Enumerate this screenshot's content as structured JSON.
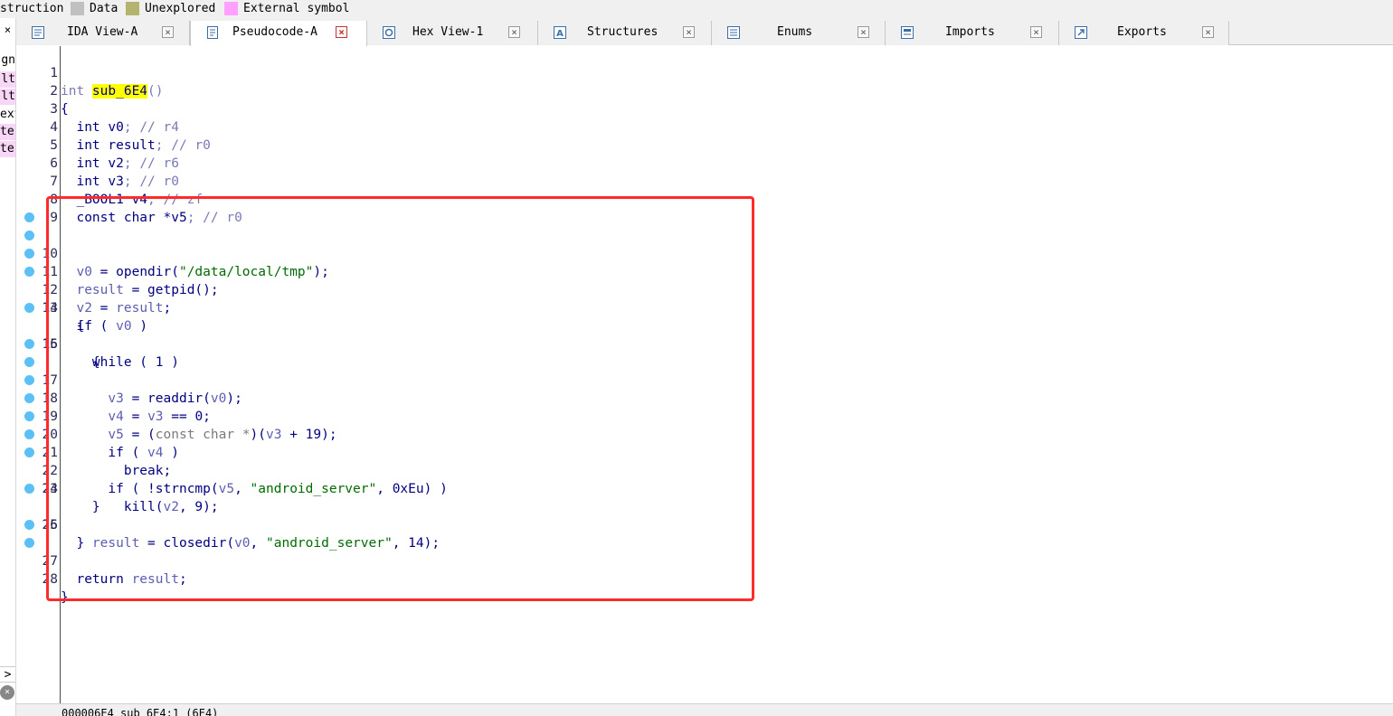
{
  "legend": [
    {
      "label": "struction",
      "color": ""
    },
    {
      "label": "Data",
      "color": "#c0c0c0"
    },
    {
      "label": "Unexplored",
      "color": "#b4b46e"
    },
    {
      "label": "External symbol",
      "color": "#ffa0ff"
    }
  ],
  "left_panel": {
    "close_glyph": "×",
    "rows": [
      "gn",
      "lt",
      "lt",
      "ext",
      "ter",
      "ter"
    ],
    "scroll_glyph": ">",
    "close_circle_glyph": "×"
  },
  "tabs": [
    {
      "label": "IDA View-A",
      "icon": "ida-view-icon",
      "active": false
    },
    {
      "label": "Pseudocode-A",
      "icon": "pseudocode-icon",
      "active": true
    },
    {
      "label": "Hex View-1",
      "icon": "hex-view-icon",
      "active": false
    },
    {
      "label": "Structures",
      "icon": "structures-icon",
      "active": false
    },
    {
      "label": "Enums",
      "icon": "enums-icon",
      "active": false
    },
    {
      "label": "Imports",
      "icon": "imports-icon",
      "active": false
    },
    {
      "label": "Exports",
      "icon": "exports-icon",
      "active": false
    }
  ],
  "tab_close_glyph": "×",
  "code": {
    "function_name": "sub_6E4",
    "lines": [
      {
        "n": "1",
        "dot": false
      },
      {
        "n": "2",
        "dot": false
      },
      {
        "n": "3",
        "dot": false
      },
      {
        "n": "4",
        "dot": false
      },
      {
        "n": "5",
        "dot": false
      },
      {
        "n": "6",
        "dot": false
      },
      {
        "n": "7",
        "dot": false
      },
      {
        "n": "8",
        "dot": false
      },
      {
        "n": "9",
        "dot": false
      },
      {
        "n": "10",
        "dot": true
      },
      {
        "n": "11",
        "dot": true
      },
      {
        "n": "12",
        "dot": true
      },
      {
        "n": "13",
        "dot": true
      },
      {
        "n": "14",
        "dot": false
      },
      {
        "n": "15",
        "dot": true
      },
      {
        "n": "16",
        "dot": false
      },
      {
        "n": "17",
        "dot": true
      },
      {
        "n": "18",
        "dot": true
      },
      {
        "n": "19",
        "dot": true
      },
      {
        "n": "20",
        "dot": true
      },
      {
        "n": "21",
        "dot": true
      },
      {
        "n": "22",
        "dot": true
      },
      {
        "n": "23",
        "dot": true
      },
      {
        "n": "24",
        "dot": false
      },
      {
        "n": "25",
        "dot": true
      },
      {
        "n": "26",
        "dot": false
      },
      {
        "n": "27",
        "dot": true
      },
      {
        "n": "28",
        "dot": true
      }
    ],
    "text": {
      "l1_kw": "int ",
      "l1_tail": "()",
      "l2": "{",
      "l3": [
        "int ",
        "v0",
        "; // ",
        "r4"
      ],
      "l4": [
        "int ",
        "result",
        "; // ",
        "r0"
      ],
      "l5": [
        "int ",
        "v2",
        "; // ",
        "r6"
      ],
      "l6": [
        "int ",
        "v3",
        "; // ",
        "r0"
      ],
      "l7": [
        "_BOOL1 ",
        "v4",
        "; // ",
        "zf"
      ],
      "l8": [
        "const char *",
        "v5",
        "; // ",
        "r0"
      ],
      "l10": [
        "v0",
        " = opendir(",
        "\"/data/local/tmp\"",
        ");"
      ],
      "l11": [
        "result",
        " = getpid();"
      ],
      "l12": [
        "v2",
        " = ",
        "result",
        ";"
      ],
      "l13": [
        "if ( ",
        "v0",
        " )"
      ],
      "l14": "{",
      "l15": [
        "while ( ",
        "1",
        " )"
      ],
      "l16": "{",
      "l17": [
        "v3",
        " = readdir(",
        "v0",
        ");"
      ],
      "l18": [
        "v4",
        " = ",
        "v3",
        " == 0;"
      ],
      "l19": [
        "v5",
        " = (",
        "const char *",
        ")(",
        "v3",
        " + 19);"
      ],
      "l20": [
        "if ( ",
        "v4",
        " )"
      ],
      "l21": "break;",
      "l22": [
        "if ( !strncmp(",
        "v5",
        ", ",
        "\"android_server\"",
        ", 0xEu) )"
      ],
      "l23": [
        "kill(",
        "v2",
        ", 9);"
      ],
      "l24": "}",
      "l25": [
        "result",
        " = closedir(",
        "v0",
        ", ",
        "\"android_server\"",
        ", 14);"
      ],
      "l26": "}",
      "l27": [
        "return ",
        "result",
        ";"
      ],
      "l28": "}"
    }
  },
  "statusbar": "000006E4 sub_6E4:1 (6E4)",
  "colors": {
    "annotation": "#ff2a2a",
    "breakpoint_dot": "#5bc0f5",
    "highlight": "#ffff00",
    "string": "#006b00"
  }
}
